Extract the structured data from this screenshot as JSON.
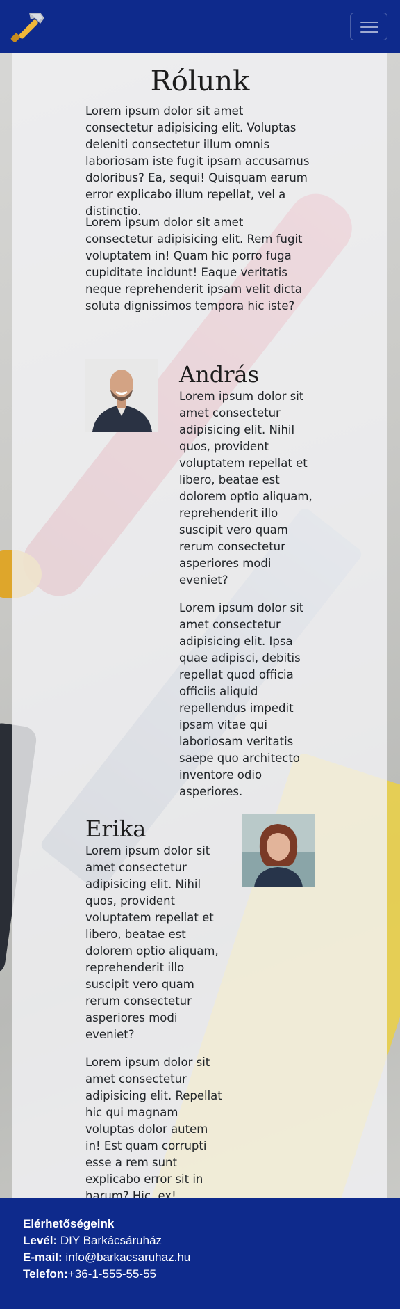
{
  "page_title": "Rólunk",
  "intro": [
    "Lorem ipsum dolor sit amet consectetur adipisicing elit. Voluptas deleniti consectetur illum omnis laboriosam iste fugit ipsam accusamus doloribus? Ea, sequi! Quisquam earum error explicabo illum repellat, vel a distinctio.",
    "Lorem ipsum dolor sit amet consectetur adipisicing elit. Rem fugit voluptatem in! Quam hic porro fuga cupiditate incidunt! Eaque veritatis neque reprehenderit ipsam velit dicta soluta dignissimos tempora hic iste?"
  ],
  "people": [
    {
      "name": "András",
      "paragraphs": [
        "Lorem ipsum dolor sit amet consectetur adipisicing elit. Nihil quos, provident voluptatem repellat et libero, beatae est dolorem optio aliquam, reprehenderit illo suscipit vero quam rerum consectetur asperiores modi eveniet?",
        "Lorem ipsum dolor sit amet consectetur adipisicing elit. Ipsa quae adipisci, debitis repellat quod officia officiis aliquid repellendus impedit ipsam vitae qui laboriosam veritatis saepe quo architecto inventore odio asperiores."
      ]
    },
    {
      "name": "Erika",
      "paragraphs": [
        "Lorem ipsum dolor sit amet consectetur adipisicing elit. Nihil quos, provident voluptatem repellat et libero, beatae est dolorem optio aliquam, reprehenderit illo suscipit vero quam rerum consectetur asperiores modi eveniet?",
        "Lorem ipsum dolor sit amet consectetur adipisicing elit. Repellat hic qui magnam voluptas dolor autem in! Est quam corrupti esse a rem sunt explicabo error sit in harum? Hic, ex!"
      ]
    }
  ],
  "footer": {
    "heading": "Elérhetőségeink",
    "mail_label": "Levél:",
    "mail_value": "DIY Barkácsáruház",
    "email_label": "E-mail:",
    "email_value": "info@barkacsaruhaz.hu",
    "phone_label": "Telefon:",
    "phone_value": "+36-1-555-55-55"
  },
  "icons": {
    "brand": "hammer-icon",
    "menu": "hamburger-menu-icon"
  },
  "colors": {
    "navbar": "#0e2a8c",
    "footer": "#0e2a8c",
    "panel": "#f2f2f4"
  }
}
